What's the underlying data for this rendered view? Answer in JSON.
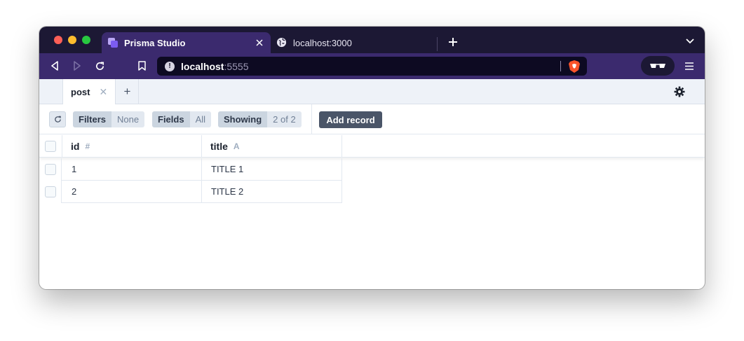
{
  "browser": {
    "tabs": [
      {
        "title": "Prisma Studio",
        "active": true
      },
      {
        "title": "localhost:3000",
        "active": false
      }
    ],
    "url": {
      "host": "localhost",
      "port": ":5555"
    }
  },
  "studio": {
    "tabs": [
      {
        "label": "post"
      }
    ],
    "actions": {
      "filters": {
        "key": "Filters",
        "value": "None"
      },
      "fields": {
        "key": "Fields",
        "value": "All"
      },
      "showing": {
        "key": "Showing",
        "value": "2 of 2"
      },
      "add_record": "Add record"
    },
    "columns": [
      {
        "name": "id",
        "type_icon": "#"
      },
      {
        "name": "title",
        "type_icon": "A"
      }
    ],
    "rows": [
      {
        "id": "1",
        "title": "TITLE 1"
      },
      {
        "id": "2",
        "title": "TITLE 2"
      }
    ]
  },
  "colors": {
    "tab_strip": "#1c1834",
    "toolbar": "#3b2a6e",
    "url_bar": "#0d0a22",
    "add_record": "#4a5568"
  }
}
